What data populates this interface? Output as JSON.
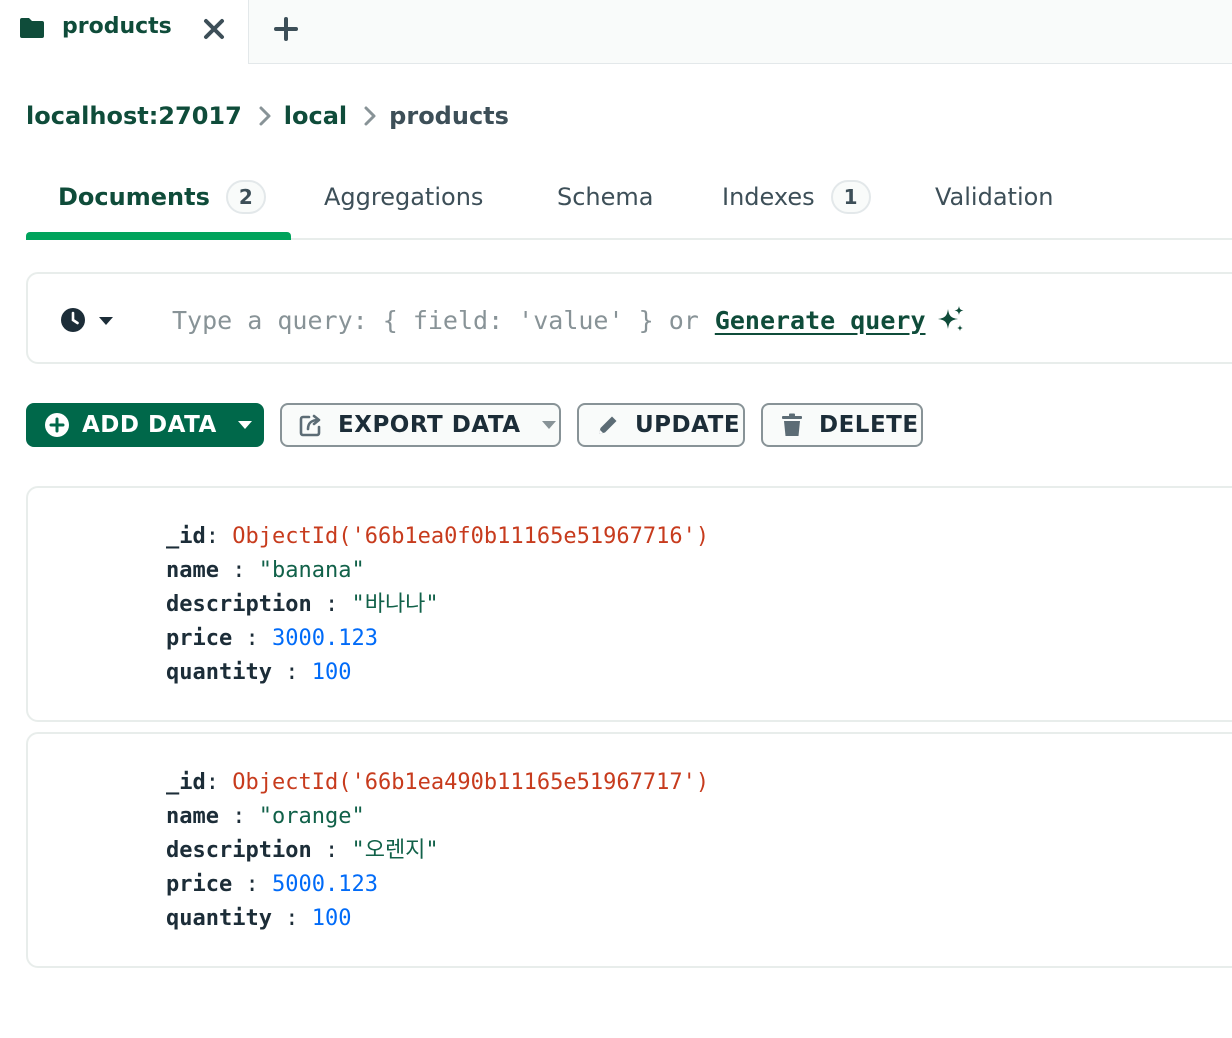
{
  "tab": {
    "label": "products",
    "icon": "folder-icon"
  },
  "breadcrumb": {
    "host": "localhost:27017",
    "database": "local",
    "collection": "products"
  },
  "tabs": [
    {
      "label": "Documents",
      "badge": "2"
    },
    {
      "label": "Aggregations"
    },
    {
      "label": "Schema"
    },
    {
      "label": "Indexes",
      "badge": "1"
    },
    {
      "label": "Validation"
    }
  ],
  "query": {
    "placeholder": "Type a query: { field: 'value' } or",
    "generate_label": "Generate query"
  },
  "toolbar": {
    "add_data": "ADD DATA",
    "export_data": "EXPORT DATA",
    "update": "UPDATE",
    "delete": "DELETE"
  },
  "documents": [
    {
      "id_key": "_id",
      "id_value": "ObjectId('66b1ea0f0b11165e51967716')",
      "name_key": "name",
      "name_value": "\"banana\"",
      "description_key": "description",
      "description_value": "\"바나나\"",
      "price_key": "price",
      "price_value": "3000.123",
      "quantity_key": "quantity",
      "quantity_value": "100"
    },
    {
      "id_key": "_id",
      "id_value": "ObjectId('66b1ea490b11165e51967717')",
      "name_key": "name",
      "name_value": "\"orange\"",
      "description_key": "description",
      "description_value": "\"오렌지\"",
      "price_key": "price",
      "price_value": "5000.123",
      "quantity_key": "quantity",
      "quantity_value": "100"
    }
  ],
  "colors": {
    "accent": "#00684a",
    "underline": "#00a35c",
    "objectid": "#c73b1d",
    "string": "#116149",
    "number": "#016bf8"
  }
}
